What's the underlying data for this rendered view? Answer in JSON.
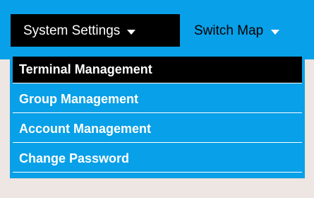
{
  "navbar": {
    "items": [
      {
        "label": "System Settings",
        "icon": "chevron-down-icon"
      },
      {
        "label": "Switch Map",
        "icon": "chevron-down-icon"
      }
    ]
  },
  "dropdown": {
    "items": [
      {
        "label": "Terminal Management",
        "active": true
      },
      {
        "label": "Group Management",
        "active": false
      },
      {
        "label": "Account Management",
        "active": false
      },
      {
        "label": "Change Password",
        "active": false
      }
    ]
  },
  "colors": {
    "primary_blue": "#08a0e8",
    "active_black": "#000000",
    "background": "#ede6e3",
    "text_white": "#ffffff"
  }
}
